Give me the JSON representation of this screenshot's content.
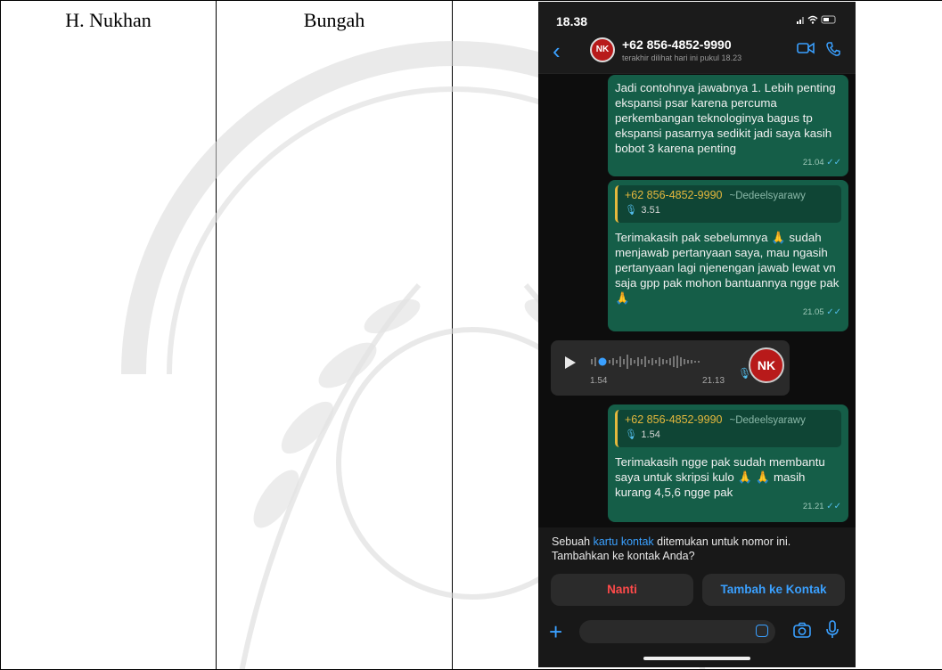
{
  "table": {
    "name": "H. Nukhan",
    "location": "Bungah"
  },
  "status_bar": {
    "time": "18.38"
  },
  "chat": {
    "contact_number": "+62 856-4852-9990",
    "last_seen": "terakhir dilihat hari ini pukul 18.23",
    "avatar_initials": "NK",
    "messages": [
      {
        "direction": "outgoing",
        "text": "Jadi contohnya jawabnya 1. Lebih penting ekspansi psar karena percuma perkembangan teknologinya bagus tp ekspansi pasarnya sedikit jadi saya kasih bobot 3 karena penting",
        "time": "21.04"
      },
      {
        "direction": "outgoing",
        "quote": {
          "number": "+62 856-4852-9990",
          "name": "~Dedeelsyarawy",
          "duration": "3.51"
        },
        "text": "Terimakasih pak sebelumnya 🙏 sudah menjawab pertanyaan saya, mau ngasih pertanyaan lagi njenengan jawab lewat vn saja gpp pak mohon bantuannya ngge pak 🙏",
        "time": "21.05"
      },
      {
        "direction": "incoming",
        "type": "voice",
        "duration": "1.54",
        "time": "21.13"
      },
      {
        "direction": "outgoing",
        "quote": {
          "number": "+62 856-4852-9990",
          "name": "~Dedeelsyarawy",
          "duration": "1.54"
        },
        "text": "Terimakasih ngge pak sudah membantu saya untuk skripsi kulo 🙏 🙏 masih kurang 4,5,6 ngge pak",
        "time": "21.21"
      }
    ]
  },
  "contact_prompt": {
    "text_before": "Sebuah ",
    "link": "kartu kontak",
    "text_after": " ditemukan untuk nomor ini. Tambahkan ke kontak Anda?",
    "later_label": "Nanti",
    "add_label": "Tambah ke Kontak"
  },
  "colors": {
    "outgoing_bubble": "#155e48",
    "incoming_bubble": "#2a2a2a",
    "accent_blue": "#3aa0ff",
    "danger_red": "#ff4a4a",
    "quote_gold": "#e5b83d"
  }
}
